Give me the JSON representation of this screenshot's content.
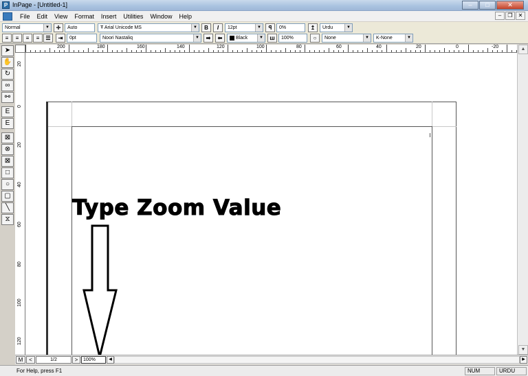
{
  "window": {
    "title": "InPage - [Untitled-1]"
  },
  "menu": {
    "items": [
      "File",
      "Edit",
      "View",
      "Format",
      "Insert",
      "Utilities",
      "Window",
      "Help"
    ]
  },
  "toolbar1": {
    "style": "Normal",
    "leading": "Auto",
    "english_font": "Arial Unicode MS",
    "font_size": "12pt",
    "tracking": "0%",
    "language": "Urdu"
  },
  "toolbar2": {
    "indent": "0pt",
    "urdu_font": "Noori Nastaliq",
    "color": "Black",
    "scale": "100%",
    "shadow": "None",
    "kashida": "K-None"
  },
  "ruler": {
    "h_labels": [
      "200",
      "180",
      "160",
      "140",
      "120",
      "100",
      "80",
      "60",
      "40",
      "20",
      "0",
      "-20"
    ],
    "v_labels": [
      "20",
      "0",
      "20",
      "40",
      "60",
      "80",
      "100",
      "120"
    ]
  },
  "annotation": {
    "title": "Type Zoom Value"
  },
  "bottom": {
    "page_label": "M",
    "page_number": "1/2",
    "zoom_value": "100%"
  },
  "status": {
    "help": "For Help, press F1",
    "num": "NUM",
    "lang": "URDU"
  }
}
